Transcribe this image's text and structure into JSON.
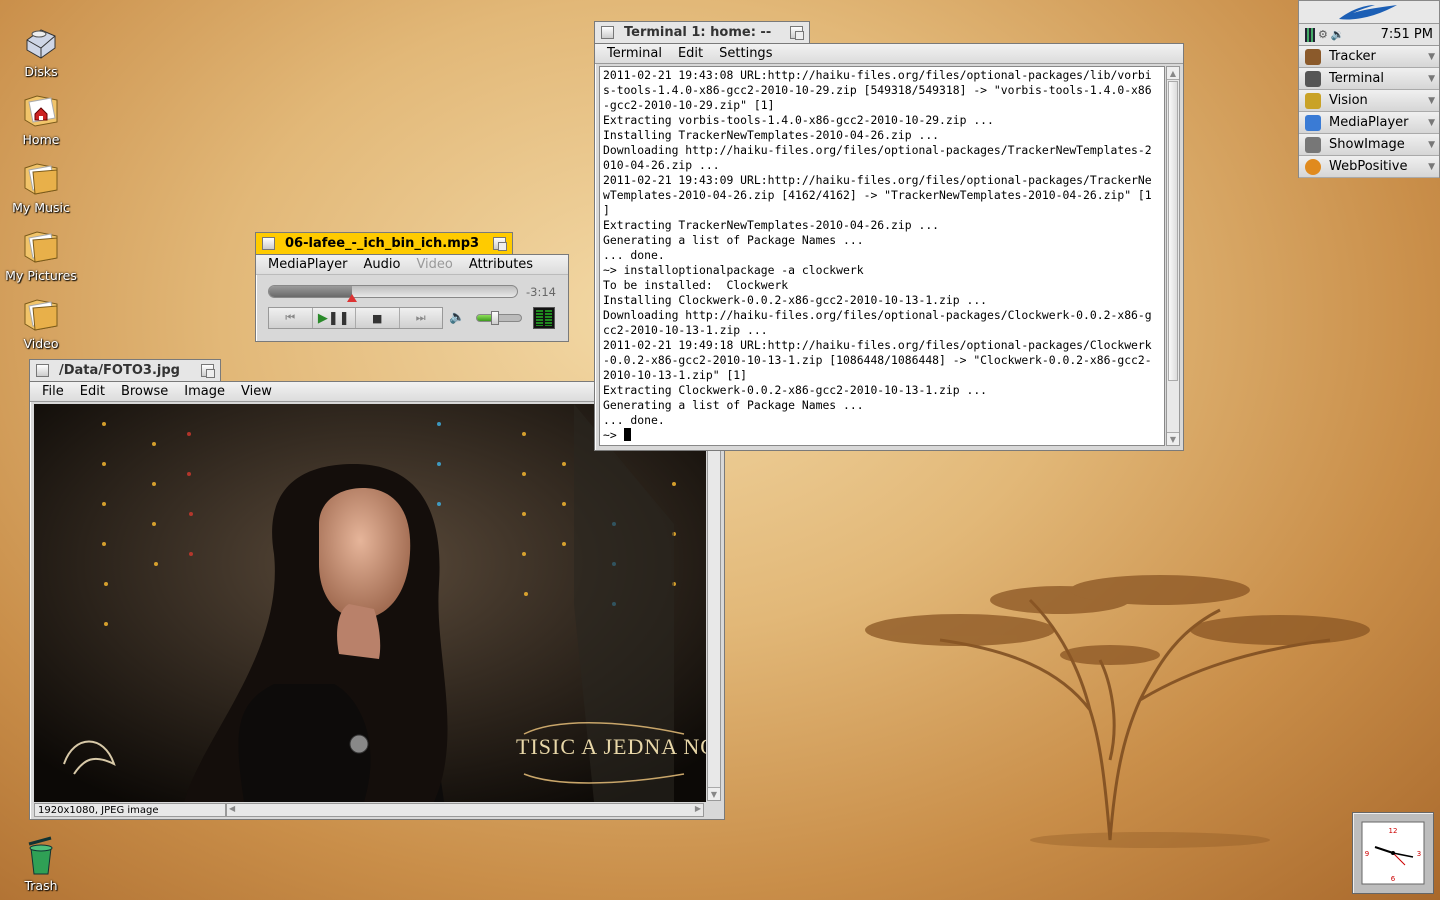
{
  "desktop_icons": [
    {
      "label": "Disks",
      "icon": "disks-icon"
    },
    {
      "label": "Home",
      "icon": "home-folder-icon"
    },
    {
      "label": "My Music",
      "icon": "folder-icon"
    },
    {
      "label": "My Pictures",
      "icon": "folder-icon"
    },
    {
      "label": "Video",
      "icon": "folder-icon"
    },
    {
      "label": "Trash",
      "icon": "trash-icon"
    }
  ],
  "terminal": {
    "title": "Terminal 1: home: --",
    "menu": [
      "Terminal",
      "Edit",
      "Settings"
    ],
    "lines": [
      "2011-02-21 19:43:08 URL:http://haiku-files.org/files/optional-packages/lib/vorbi",
      "s-tools-1.4.0-x86-gcc2-2010-10-29.zip [549318/549318] -> \"vorbis-tools-1.4.0-x86",
      "-gcc2-2010-10-29.zip\" [1]",
      "Extracting vorbis-tools-1.4.0-x86-gcc2-2010-10-29.zip ...",
      "Installing TrackerNewTemplates-2010-04-26.zip ...",
      "Downloading http://haiku-files.org/files/optional-packages/TrackerNewTemplates-2",
      "010-04-26.zip ...",
      "2011-02-21 19:43:09 URL:http://haiku-files.org/files/optional-packages/TrackerNe",
      "wTemplates-2010-04-26.zip [4162/4162] -> \"TrackerNewTemplates-2010-04-26.zip\" [1",
      "]",
      "Extracting TrackerNewTemplates-2010-04-26.zip ...",
      "Generating a list of Package Names ...",
      "... done.",
      "~> installoptionalpackage -a clockwerk",
      "To be installed:  Clockwerk",
      "Installing Clockwerk-0.0.2-x86-gcc2-2010-10-13-1.zip ...",
      "Downloading http://haiku-files.org/files/optional-packages/Clockwerk-0.0.2-x86-g",
      "cc2-2010-10-13-1.zip ...",
      "2011-02-21 19:49:18 URL:http://haiku-files.org/files/optional-packages/Clockwerk",
      "-0.0.2-x86-gcc2-2010-10-13-1.zip [1086448/1086448] -> \"Clockwerk-0.0.2-x86-gcc2-",
      "2010-10-13-1.zip\" [1]",
      "Extracting Clockwerk-0.0.2-x86-gcc2-2010-10-13-1.zip ...",
      "Generating a list of Package Names ...",
      "... done."
    ],
    "prompt": "~> "
  },
  "mediaplayer": {
    "title": "06-lafee_-_ich_bin_ich.mp3",
    "menu": [
      "MediaPlayer",
      "Audio",
      "Video",
      "Attributes"
    ],
    "disabled_menu": "Video",
    "time_remaining": "-3:14",
    "progress": 0.33,
    "volume": 0.4
  },
  "showimage": {
    "title": "/Data/FOTO3.jpg",
    "menu": [
      "File",
      "Edit",
      "Browse",
      "Image",
      "View"
    ],
    "status": "1920x1080, JPEG image",
    "watermark": "TISIC A JEDNA NOC"
  },
  "deskbar": {
    "clock": "7:51 PM",
    "apps": [
      {
        "label": "Tracker",
        "color": "#8b5a2b"
      },
      {
        "label": "Terminal",
        "color": "#555555"
      },
      {
        "label": "Vision",
        "color": "#c9a227"
      },
      {
        "label": "MediaPlayer",
        "color": "#3a7bd5"
      },
      {
        "label": "ShowImage",
        "color": "#777777"
      },
      {
        "label": "WebPositive",
        "color": "#e08a1e"
      }
    ]
  },
  "colors": {
    "active_tab": "#ffcb00",
    "inactive_tab": "#e6e6e6",
    "desktop": "#d9a867"
  }
}
